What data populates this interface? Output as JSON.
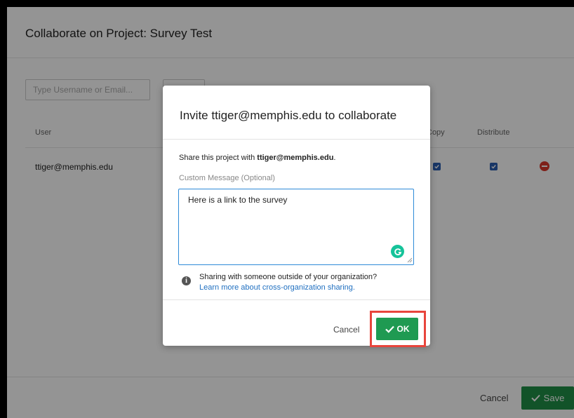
{
  "page": {
    "title": "Collaborate on Project: Survey Test",
    "search": {
      "placeholder": "Type Username or Email..."
    },
    "columns": {
      "user": "User",
      "copy": "Copy",
      "distribute": "Distribute"
    },
    "rows": [
      {
        "user": "ttiger@memphis.edu",
        "copy": true,
        "distribute": true
      }
    ],
    "cancel_label": "Cancel",
    "save_label": "Save",
    "accent_color": "#1f8f47"
  },
  "modal": {
    "title": "Invite ttiger@memphis.edu to collaborate",
    "share_prefix": "Share this project with",
    "share_email": "ttiger@memphis.edu",
    "share_suffix": ".",
    "message_label": "Custom Message (Optional)",
    "message_value": "Here is a link to the survey",
    "org_question": "Sharing with someone outside of your organization?",
    "org_link": "Learn more about cross-organization sharing.",
    "cancel_label": "Cancel",
    "ok_label": "OK",
    "highlight_color": "#e8453c"
  }
}
